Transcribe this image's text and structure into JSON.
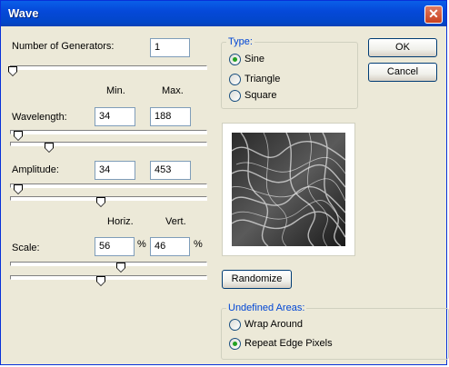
{
  "window": {
    "title": "Wave",
    "close_glyph": "✕"
  },
  "generators": {
    "label": "Number of Generators:",
    "value": "1"
  },
  "col_headers": {
    "min": "Min.",
    "max": "Max.",
    "horiz": "Horiz.",
    "vert": "Vert."
  },
  "wavelength": {
    "label": "Wavelength:",
    "min": "34",
    "max": "188"
  },
  "amplitude": {
    "label": "Amplitude:",
    "min": "34",
    "max": "453"
  },
  "scale": {
    "label": "Scale:",
    "horiz": "56",
    "horiz_unit": "%",
    "vert": "46",
    "vert_unit": "%"
  },
  "type_group": {
    "title": "Type:",
    "options": [
      "Sine",
      "Triangle",
      "Square"
    ],
    "selected": "Sine"
  },
  "buttons": {
    "ok": "OK",
    "cancel": "Cancel",
    "randomize": "Randomize"
  },
  "undefined_areas": {
    "title": "Undefined Areas:",
    "options": [
      "Wrap Around",
      "Repeat Edge Pixels"
    ],
    "selected": "Repeat Edge Pixels"
  },
  "preview": {
    "icon": "wave-preview-texture"
  },
  "colors": {
    "title_bar": "#0549d9",
    "group_title": "#0046d5",
    "dialog_bg": "#ece9d8",
    "radio_on": "#21a121"
  }
}
